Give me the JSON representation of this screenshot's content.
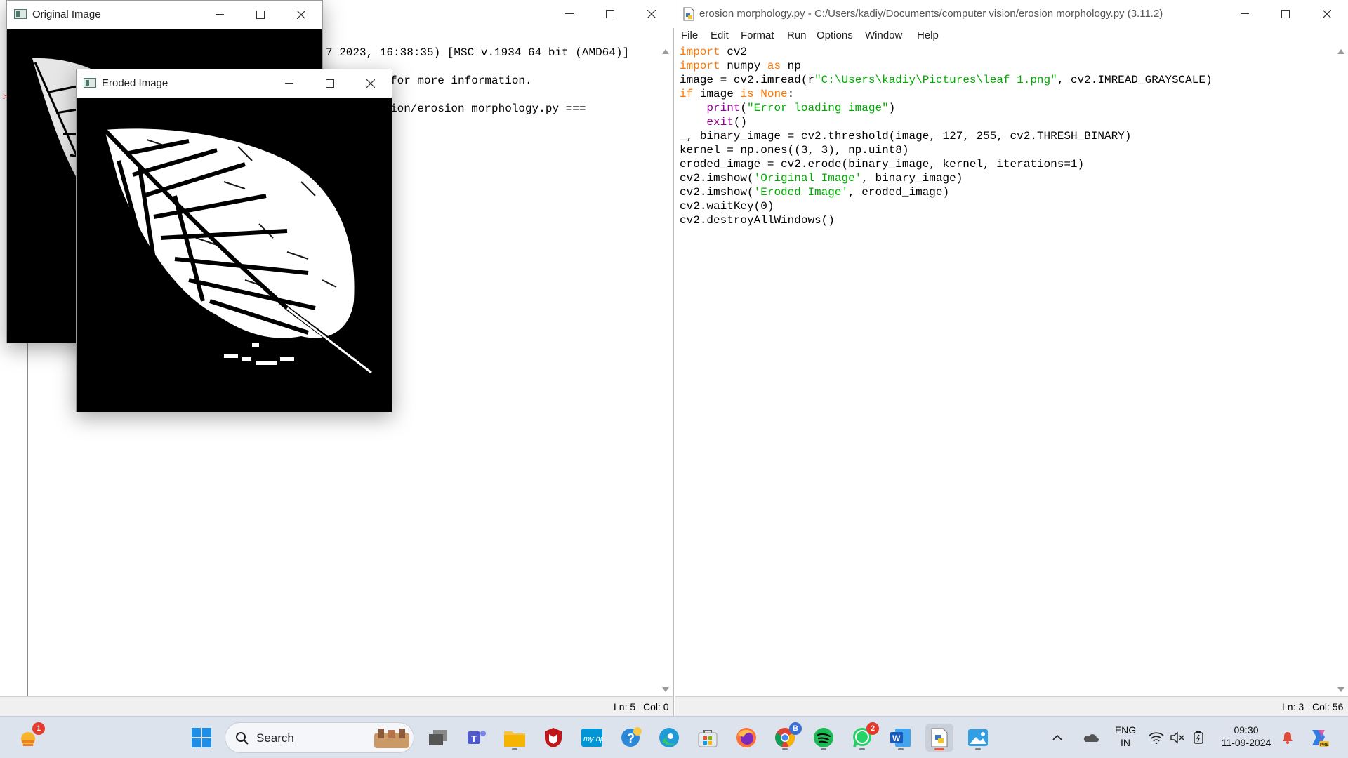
{
  "shell_window": {
    "lines": [
      "7 2023, 16:38:35) [MSC v.1934 64 bit (AMD64)]",
      "for more information.",
      "ion/erosion morphology.py ==="
    ],
    "status": {
      "ln": "Ln: 5",
      "col": "Col: 0"
    }
  },
  "editor_window": {
    "title": "erosion morphology.py - C:/Users/kadiy/Documents/computer vision/erosion morphology.py (3.11.2)",
    "menu": [
      "File",
      "Edit",
      "Format",
      "Run",
      "Options",
      "Window",
      "Help"
    ],
    "code": [
      "import cv2",
      "import numpy as np",
      "image = cv2.imread(r\"C:\\Users\\kadiy\\Pictures\\leaf 1.png\", cv2.IMREAD_GRAYSCALE)",
      "if image is None:",
      "    print(\"Error loading image\")",
      "    exit()",
      "_, binary_image = cv2.threshold(image, 127, 255, cv2.THRESH_BINARY)",
      "kernel = np.ones((3, 3), np.uint8)",
      "eroded_image = cv2.erode(binary_image, kernel, iterations=1)",
      "cv2.imshow('Original Image', binary_image)",
      "cv2.imshow('Eroded Image', eroded_image)",
      "cv2.waitKey(0)",
      "cv2.destroyAllWindows()"
    ],
    "status": {
      "ln": "Ln: 3",
      "col": "Col: 56"
    }
  },
  "original_window": {
    "title": "Original Image"
  },
  "eroded_window": {
    "title": "Eroded Image"
  },
  "taskbar": {
    "search_label": "Search",
    "weather_badge": "1",
    "whatsapp_badge": "2",
    "chrome_badge": "B",
    "language": "ENG",
    "region": "IN",
    "time": "09:30",
    "date": "11-09-2024",
    "icons": [
      "weather-icon",
      "windows-start-icon",
      "task-view-icon",
      "teams-icon",
      "file-explorer-icon",
      "mcafee-icon",
      "myhp-icon",
      "help-icon",
      "edge-icon",
      "store-icon",
      "firefox-icon",
      "chrome-icon",
      "spotify-icon",
      "whatsapp-icon",
      "word-icon",
      "python-idle-icon",
      "photos-icon"
    ]
  },
  "colors": {
    "keyword": "#ff7700",
    "string": "#00aa00",
    "builtin": "#900090",
    "taskbar": "#dde3ec"
  }
}
